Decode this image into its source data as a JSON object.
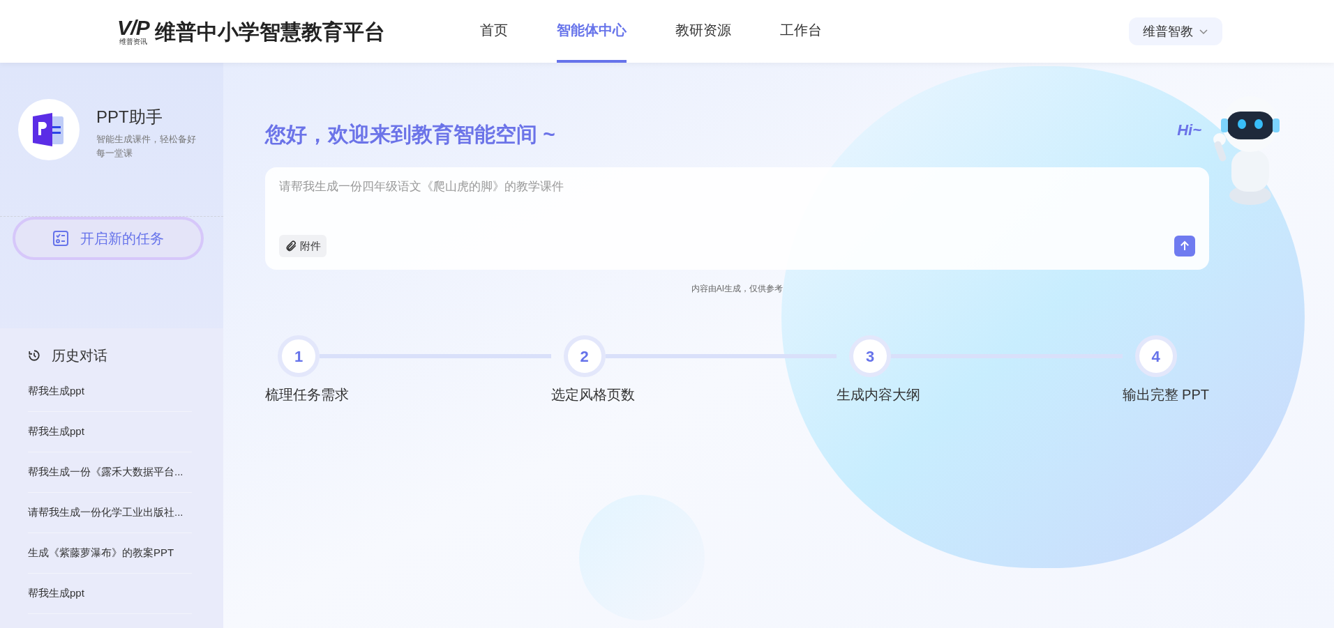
{
  "header": {
    "logo_mark": "V/P",
    "logo_caption": "维普资讯",
    "site_title": "维普中小学智慧教育平台",
    "nav": [
      {
        "label": "首页",
        "selected": false
      },
      {
        "label": "智能体中心",
        "selected": true
      },
      {
        "label": "教研资源",
        "selected": false
      },
      {
        "label": "工作台",
        "selected": false
      }
    ],
    "user_menu": "维普智教"
  },
  "sidebar": {
    "agent": {
      "name": "PPT助手",
      "description": "智能生成课件，轻松备好每一堂课"
    },
    "new_task": "开启新的任务",
    "history_title": "历史对话",
    "history": [
      "帮我生成ppt",
      "帮我生成ppt",
      "帮我生成一份《露禾大数据平台...",
      "请帮我生成一份化学工业出版社...",
      "生成《紫藤萝瀑布》的教案PPT",
      "帮我生成ppt"
    ]
  },
  "main": {
    "greeting": "您好，欢迎来到教育智能空间 ~",
    "mascot_greeting": "Hi~",
    "prompt": {
      "placeholder": "请帮我生成一份四年级语文《爬山虎的脚》的教学课件",
      "attach": "附件"
    },
    "disclaimer": "内容由AI生成，仅供参考",
    "steps": [
      {
        "number": "1",
        "label": "梳理任务需求"
      },
      {
        "number": "2",
        "label": "选定风格页数"
      },
      {
        "number": "3",
        "label": "生成内容大纲"
      },
      {
        "number": "4",
        "label": "输出完整 PPT"
      }
    ]
  }
}
